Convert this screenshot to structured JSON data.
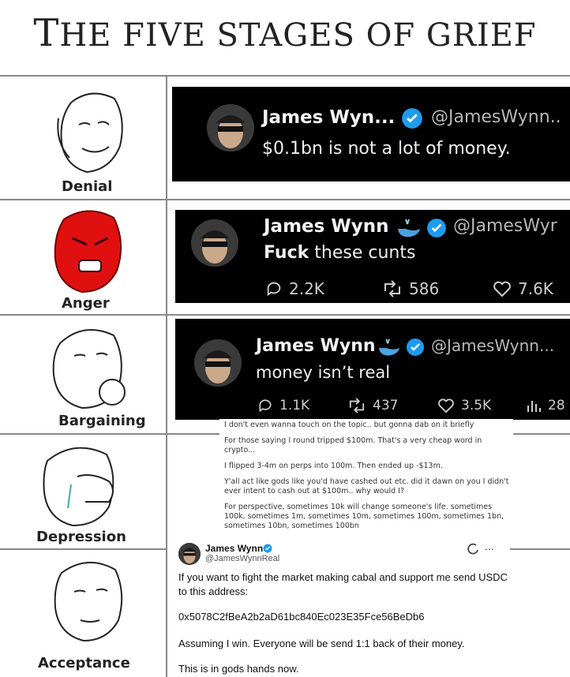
{
  "title": {
    "prefix": "T",
    "rest": "HE FIVE STAGES OF GRIEF"
  },
  "stages": [
    {
      "label": "Denial"
    },
    {
      "label": "Anger"
    },
    {
      "label": "Bargaining"
    },
    {
      "label": "Depression"
    },
    {
      "label": "Acceptance"
    }
  ],
  "tweets": [
    {
      "name": "James Wyn...",
      "handle": "@JamesWynn..",
      "text": "$0.1bn is not a lot of money."
    },
    {
      "name": "James Wynn",
      "handle": "@JamesWyr",
      "text_bold": "Fuck",
      "text_rest": " these cunts",
      "replies": "2.2K",
      "retweets": "586",
      "likes": "7.6K"
    },
    {
      "name": "James Wynn",
      "handle": "@JamesWynn...",
      "text": "money isn’t real",
      "replies": "1.1K",
      "retweets": "437",
      "likes": "3.5K",
      "views": "28"
    }
  ],
  "notes": {
    "p1": "I don't even wanna touch on the topic.. but gonna dab on it briefly",
    "p2": "For those saying I round tripped $100m. That's a very cheap word in crypto...",
    "p3": "I flipped 3-4m on perps into 100m. Then ended up -$13m.",
    "p4": "Y'all act like gods like you'd have cashed out etc. did it dawn on you I didn't ever intent to cash out at $100m.. why would I?",
    "p5": "For perspective, sometimes 10k will change someone's life. sometimes 100k, sometimes 1m, sometimes 10m, sometimes 100m, sometimes 1bn, sometimes 10bn, sometimes 100bn"
  },
  "card": {
    "name": "James Wynn",
    "handle": "@JamesWynnReal",
    "l1": "If you want to fight the market making cabal and support me send USDC",
    "l2": "to this address:",
    "l3": "0x5078C2fBeA2b2aD61bc840Ec023E35Fce56BeDb6",
    "l4": "Assuming I win. Everyone will be send 1:1 back of their money.",
    "l5": "This is in gods hands now.",
    "more": "..."
  },
  "colors": {
    "tweet_bg": "#000000",
    "verified": "#1d9bf0",
    "anger_face": "#e01010"
  }
}
